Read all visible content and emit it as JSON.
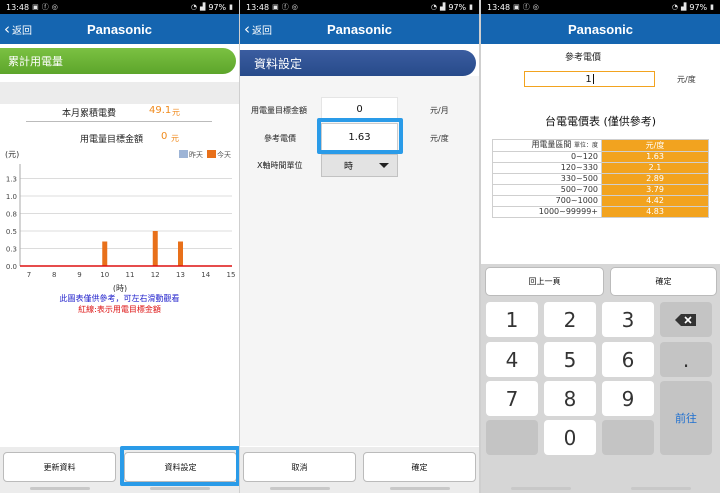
{
  "status": {
    "time": "13:48",
    "notif_icons": [
      "image-icon",
      "facebook-icon",
      "circle-app-icon"
    ],
    "right_icons": [
      "alarm-icon",
      "wifi-icon",
      "signal-icon"
    ],
    "battery": "97%"
  },
  "nav": {
    "back_label": "返回",
    "title": "Panasonic"
  },
  "panel1": {
    "section_title": "累計用電量",
    "month_cost_label": "本月累積電費",
    "month_cost_value": "49.1",
    "month_cost_unit": "元",
    "target_label": "用電量目標金額",
    "target_value": "0",
    "target_unit": "元",
    "note_blue": "此圖表僅供參考，可左右滑動觀看",
    "note_red": "紅線:表示用電目標金額",
    "btn_refresh": "更新資料",
    "btn_settings": "資料設定"
  },
  "chart_data": {
    "type": "bar",
    "ylabel": "(元)",
    "xlabel": "(時)",
    "x": [
      7,
      8,
      9,
      10,
      11,
      12,
      13,
      14,
      15
    ],
    "yticks": [
      "0.0",
      "0.3",
      "0.5",
      "0.8",
      "1.0",
      "1.3"
    ],
    "ylim": [
      0,
      1.4
    ],
    "series": [
      {
        "name": "昨天",
        "color": "#9db4d6",
        "values": [
          0,
          0,
          0,
          0,
          0,
          0,
          0,
          0,
          0
        ]
      },
      {
        "name": "今天",
        "color": "#e8701a",
        "values": [
          0,
          0,
          0,
          0.35,
          0,
          0.5,
          0.35,
          0,
          0
        ]
      }
    ],
    "target_line": 0,
    "target_color": "#dd1111",
    "legend": "top-right"
  },
  "panel2": {
    "section_title": "資料設定",
    "target_label": "用電量目標金額",
    "target_value": "0",
    "target_unit": "元/月",
    "price_label": "參考電價",
    "price_value": "1.63",
    "price_unit": "元/度",
    "xaxis_label": "X軸時間單位",
    "xaxis_value": "時",
    "btn_cancel": "取消",
    "btn_ok": "確定"
  },
  "panel3": {
    "price_label": "參考電價",
    "price_value": "1",
    "price_unit": "元/度",
    "table_title": "台電電價表 (僅供參考)",
    "table_head": [
      "用電量區間",
      "單位：度",
      "元/度"
    ],
    "rows": [
      {
        "range": "0~120",
        "price": "1.63"
      },
      {
        "range": "120~330",
        "price": "2.1"
      },
      {
        "range": "330~500",
        "price": "2.89"
      },
      {
        "range": "500~700",
        "price": "3.79"
      },
      {
        "range": "700~1000",
        "price": "4.42"
      },
      {
        "range": "1000~99999+",
        "price": "4.83"
      }
    ],
    "btn_prev": "回上一頁",
    "btn_ok": "確定",
    "keys": [
      "1",
      "2",
      "3",
      "4",
      "5",
      "6",
      "7",
      "8",
      "9",
      "0",
      "."
    ],
    "key_go": "前往",
    "backspace_icon": "backspace-icon"
  },
  "colors": {
    "nav_blue": "#1565b0",
    "green": "#6cb236",
    "section_blue": "#2f5395",
    "orange": "#f2a31f",
    "highlight": "#2a9be8"
  }
}
